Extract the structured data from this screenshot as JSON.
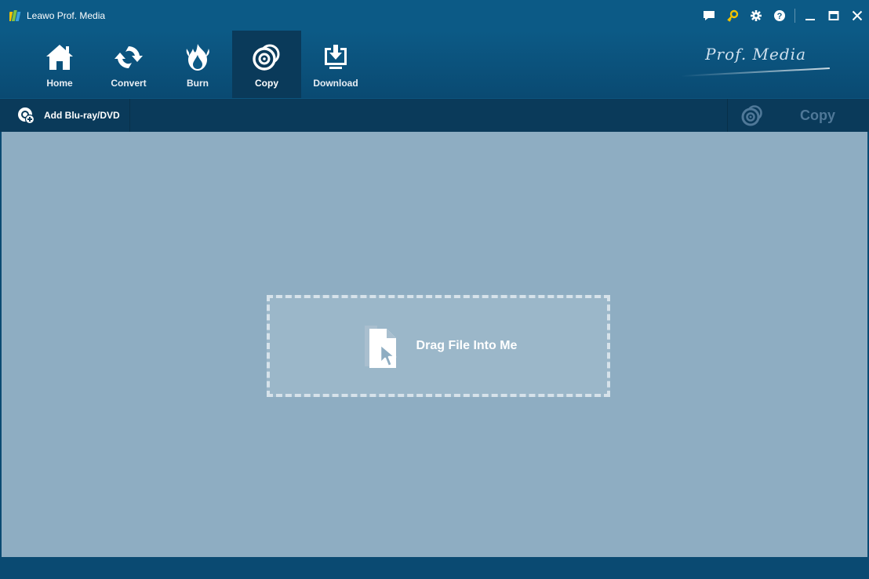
{
  "app": {
    "title": "Leawo Prof. Media"
  },
  "title_controls": [
    {
      "name": "feedback-icon",
      "label": ""
    },
    {
      "name": "key-icon",
      "label": ""
    },
    {
      "name": "gear-icon",
      "label": ""
    },
    {
      "name": "help-icon",
      "label": ""
    },
    {
      "name": "minimize-icon",
      "label": ""
    },
    {
      "name": "maximize-icon",
      "label": ""
    },
    {
      "name": "close-icon",
      "label": ""
    }
  ],
  "nav": {
    "items": [
      {
        "label": "Home",
        "icon": "home-icon"
      },
      {
        "label": "Convert",
        "icon": "convert-icon"
      },
      {
        "label": "Burn",
        "icon": "burn-icon"
      },
      {
        "label": "Copy",
        "icon": "copy-disc-icon",
        "active": true
      },
      {
        "label": "Download",
        "icon": "download-icon"
      }
    ]
  },
  "brand": {
    "text": "Prof. Media"
  },
  "toolbar": {
    "add_label": "Add Blu-ray/DVD",
    "copy_label": "Copy"
  },
  "dropzone": {
    "label": "Drag File Into Me"
  },
  "colors": {
    "titlebar": "#0c5a86",
    "toolbar": "#0a3a5a",
    "content_bg": "#8eadc2",
    "key_accent": "#f2c200"
  }
}
